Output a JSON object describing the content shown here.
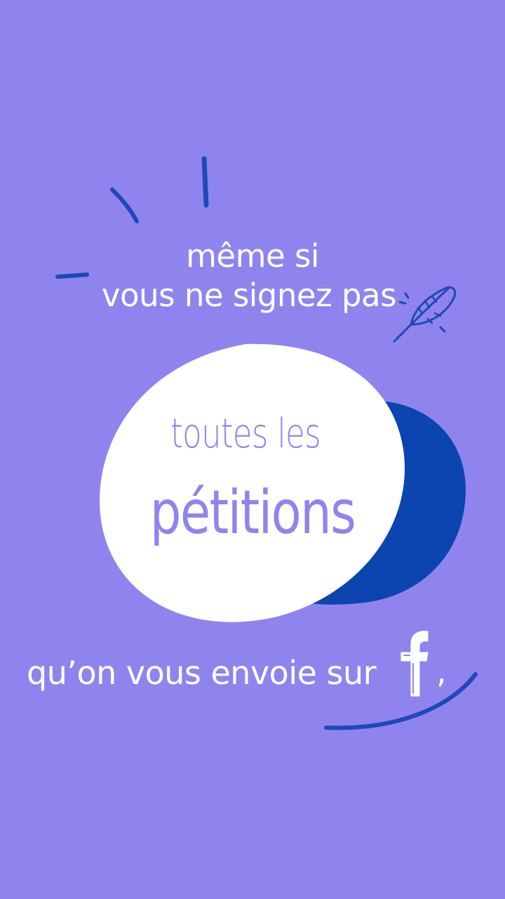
{
  "colors": {
    "background": "#8f84ee",
    "blob_white": "#ffffff",
    "blob_dark": "#0c45b0",
    "strokes": "#1f48b8",
    "text": "#ffffff",
    "blob_text": "#8f84ee"
  },
  "text": {
    "line1": "même si",
    "line2": "vous ne signez pas",
    "blob_line1": "toutes les",
    "blob_line2": "pétitions",
    "line3": "qu’on vous envoie sur",
    "comma": ","
  },
  "icons": {
    "feather": "feather-icon",
    "facebook": "facebook-f-icon"
  }
}
